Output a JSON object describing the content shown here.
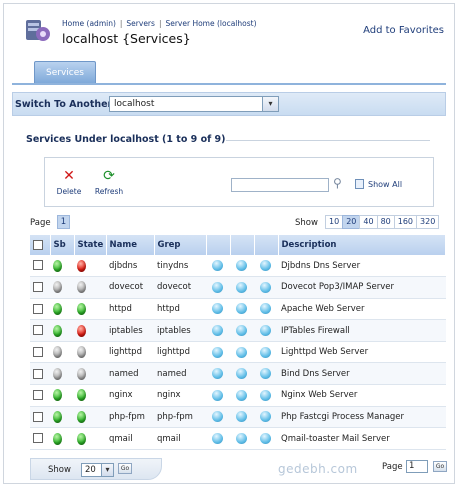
{
  "header": {
    "breadcrumbs": [
      "Home (admin)",
      "Servers",
      "Server Home (localhost)"
    ],
    "title": "localhost {Services}",
    "favorites": "Add to Favorites"
  },
  "tabs": [
    {
      "label": "Services"
    }
  ],
  "switch": {
    "label": "Switch To Another",
    "value": "localhost"
  },
  "section": {
    "title": "Services Under localhost (1 to 9 of 9)"
  },
  "toolbar": {
    "delete_label": "Delete",
    "refresh_label": "Refresh",
    "search_value": "",
    "showall_label": "Show All"
  },
  "pager": {
    "page_label": "Page",
    "current_page": "1",
    "show_label": "Show",
    "sizes": [
      "10",
      "20",
      "40",
      "80",
      "160",
      "320"
    ],
    "active_size": "20"
  },
  "table": {
    "headers": [
      "Sb",
      "State",
      "Name",
      "Grep",
      "",
      "",
      "",
      "Description"
    ],
    "rows": [
      {
        "sb": "on",
        "state": "red",
        "name": "djbdns",
        "grep": "tinydns",
        "desc": "Djbdns Dns Server"
      },
      {
        "sb": "off",
        "state": "off",
        "name": "dovecot",
        "grep": "dovecot",
        "desc": "Dovecot Pop3/IMAP Server"
      },
      {
        "sb": "on",
        "state": "on",
        "name": "httpd",
        "grep": "httpd",
        "desc": "Apache Web Server"
      },
      {
        "sb": "on",
        "state": "red",
        "name": "iptables",
        "grep": "iptables",
        "desc": "IPTables Firewall"
      },
      {
        "sb": "off",
        "state": "off",
        "name": "lighttpd",
        "grep": "lighttpd",
        "desc": "Lighttpd Web Server"
      },
      {
        "sb": "off",
        "state": "off",
        "name": "named",
        "grep": "named",
        "desc": "Bind Dns Server"
      },
      {
        "sb": "on",
        "state": "on",
        "name": "nginx",
        "grep": "nginx",
        "desc": "Nginx Web Server"
      },
      {
        "sb": "on",
        "state": "on",
        "name": "php-fpm",
        "grep": "php-fpm",
        "desc": "Php Fastcgi Process Manager"
      },
      {
        "sb": "on",
        "state": "on",
        "name": "qmail",
        "grep": "qmail",
        "desc": "Qmail-toaster Mail Server"
      }
    ]
  },
  "footer": {
    "show_label": "Show",
    "show_value": "20",
    "go_label": "Go",
    "page_label": "Page",
    "page_value": "1"
  },
  "watermark": "gedebh.com"
}
